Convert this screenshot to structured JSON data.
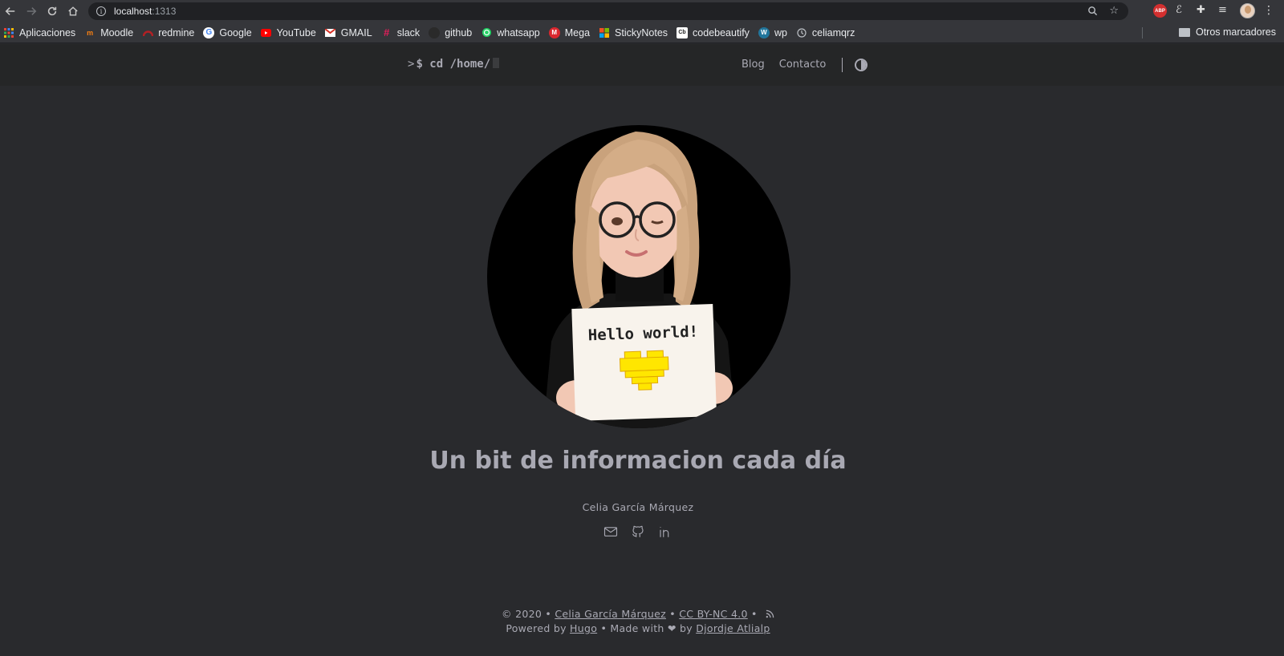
{
  "browser": {
    "url_host": "localhost",
    "url_port": ":1313",
    "bookmarks": [
      {
        "label": "Aplicaciones",
        "icon": "apps-grid-icon",
        "color": "#4285f4"
      },
      {
        "label": "Moodle",
        "icon": "moodle-icon",
        "color": "#f98012"
      },
      {
        "label": "redmine",
        "icon": "redmine-icon",
        "color": "#b32024"
      },
      {
        "label": "Google",
        "icon": "google-icon",
        "color": "#ffffff"
      },
      {
        "label": "YouTube",
        "icon": "youtube-icon",
        "color": "#ff0000"
      },
      {
        "label": "GMAIL",
        "icon": "gmail-icon",
        "color": "#d93025"
      },
      {
        "label": "slack",
        "icon": "slack-icon",
        "color": "#e01e5a"
      },
      {
        "label": "github",
        "icon": "github-icon",
        "color": "#222222"
      },
      {
        "label": "whatsapp",
        "icon": "whatsapp-icon",
        "color": "#25d366"
      },
      {
        "label": "Mega",
        "icon": "mega-icon",
        "color": "#d9272e"
      },
      {
        "label": "StickyNotes",
        "icon": "windows-icon",
        "color": "#f25022"
      },
      {
        "label": "codebeautify",
        "icon": "codebeautify-icon",
        "color": "#ffffff"
      },
      {
        "label": "wp",
        "icon": "wordpress-icon",
        "color": "#21759b"
      },
      {
        "label": "celiamqrz",
        "icon": "clock-icon",
        "color": "#bdc1c6"
      }
    ],
    "other_bookmarks": "Otros marcadores"
  },
  "site": {
    "logo_prompt": ">",
    "logo_text": "$ cd /home/",
    "menu": [
      "Blog",
      "Contacto"
    ],
    "hero_title": "Un bit de informacion cada día",
    "author": "Celia García Márquez",
    "avatar_card_text": "Hello world!",
    "socials": [
      "mail-icon",
      "github-icon",
      "linkedin-icon"
    ]
  },
  "footer": {
    "copyright": "© 2020 •",
    "author_link": "Celia García Márquez",
    "sep1": "•",
    "license_link": "CC BY-NC 4.0",
    "sep2": "•",
    "powered_by": "Powered by",
    "hugo_link": "Hugo",
    "made_with": "•  Made with ❤ by",
    "theme_author_link": "Djordje Atlialp"
  }
}
